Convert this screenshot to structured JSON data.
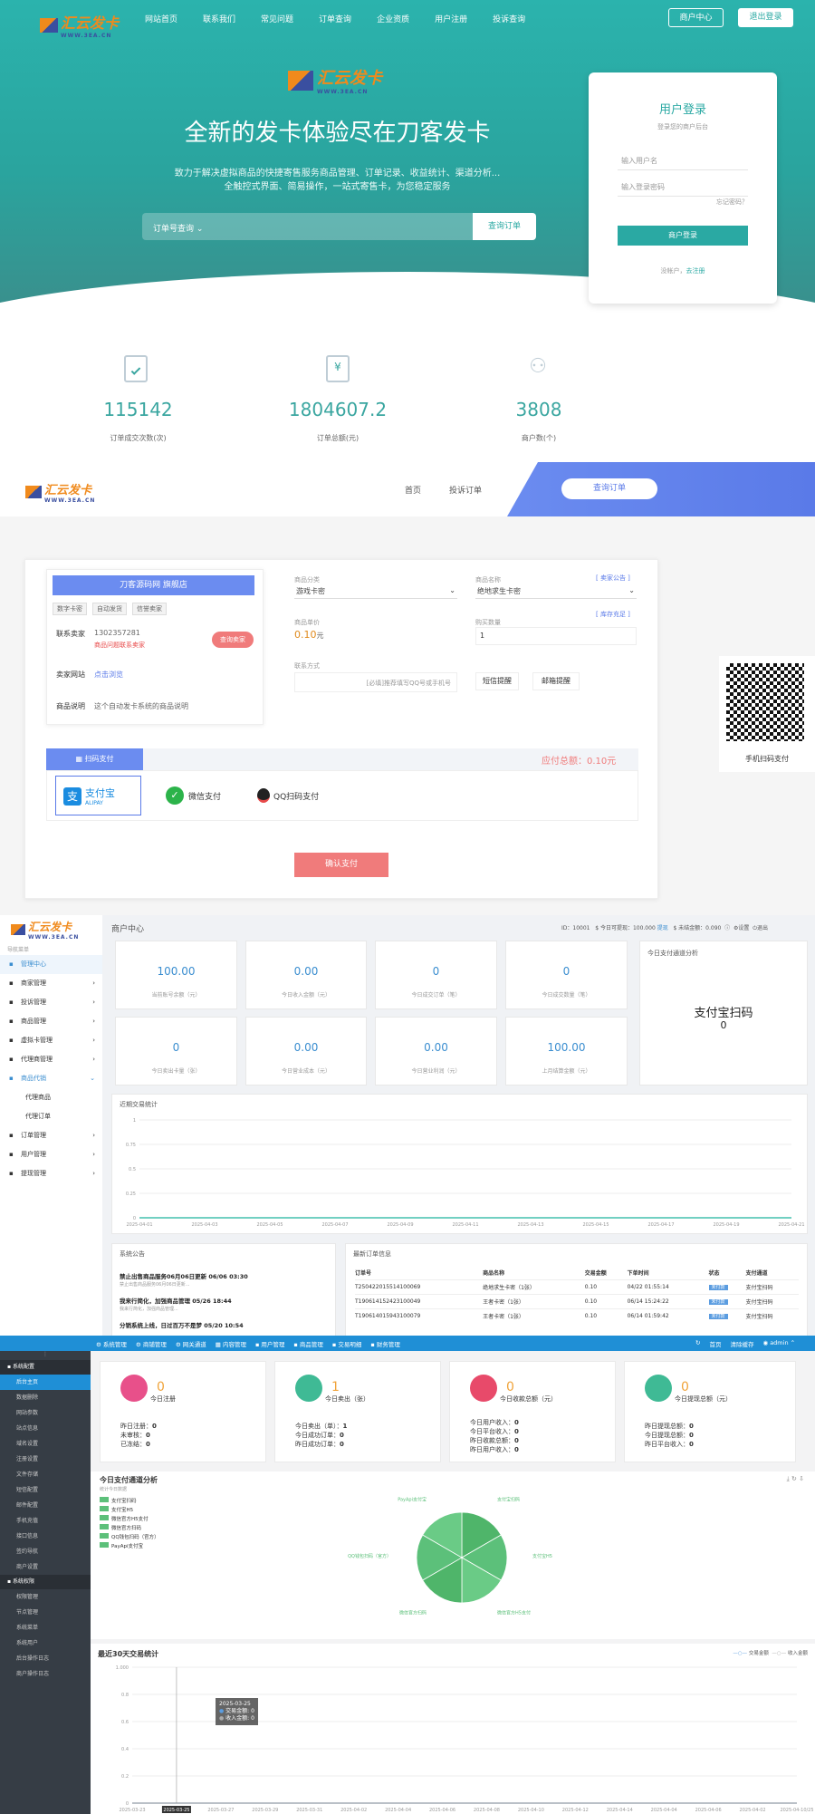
{
  "hero": {
    "logo": "汇云发卡",
    "logo_sub": "WWW.3EA.CN",
    "nav": [
      "网站首页",
      "联系我们",
      "常见问题",
      "订单查询",
      "企业资质",
      "用户注册",
      "投诉查询"
    ],
    "btn_merchant": "商户中心",
    "btn_logout": "退出登录",
    "headline": "全新的发卡体验尽在刀客发卡",
    "desc1": "致力于解决虚拟商品的快捷寄售服务商品管理、订单记录、收益统计、渠道分析...",
    "desc2": "全触控式界面、简易操作，一站式寄售卡，为您稳定服务",
    "search_select": "订单号查询",
    "search_button": "查询订单",
    "login": {
      "title": "用户登录",
      "subtitle": "登录您的商户后台",
      "user_placeholder": "输入用户名",
      "pass_placeholder": "输入登录密码",
      "forgot": "忘记密码？",
      "button": "商户登录",
      "no_account": "没帐户，",
      "register": "去注册"
    }
  },
  "stats": [
    {
      "value": "115142",
      "label": "订单成交次数(次)"
    },
    {
      "value": "1804607.2",
      "label": "订单总额(元)"
    },
    {
      "value": "3808",
      "label": "商户数(个)"
    }
  ],
  "shop": {
    "logo": "汇云发卡",
    "logo_sub": "WWW.3EA.CN",
    "nav_home": "首页",
    "nav_complaint": "投诉订单",
    "nav_query": "查询订单",
    "store_name": "刀客源码网 旗舰店",
    "tags": [
      "数字卡密",
      "自动发货",
      "信誉卖家"
    ],
    "contact_label": "联系卖家",
    "contact_value": "1302357281",
    "contact_warn": "商品问题联系卖家",
    "seller_btn": "查询卖家",
    "site_label": "卖家网站",
    "site_value": "点击浏览",
    "desc_label": "商品说明",
    "desc_value": "这个自动发卡系统的商品说明",
    "category_label": "商品分类",
    "category_value": "游戏卡密",
    "notice_link": "[ 卖家公告 ]",
    "product_label": "商品名称",
    "product_value": "绝地求生卡密",
    "price_label": "商品单价",
    "price_value": "0.10",
    "price_unit": "元",
    "stock_link": "[ 库存充足 ]",
    "qty_label": "购买数量",
    "qty_value": "1",
    "contact_way_label": "联系方式",
    "contact_way_placeholder": "[必填]推荐填写QQ号或手机号",
    "sms_btn": "短信提醒",
    "mail_btn": "邮箱提醒",
    "pay_tab": "扫码支付",
    "total_label": "应付总额：",
    "total_value": "0.10元",
    "pay_alipay": "支付宝",
    "pay_alipay_sub": "ALIPAY",
    "pay_wechat": "微信支付",
    "pay_qq": "QQ扫码支付",
    "confirm": "确认支付",
    "qr_label": "手机扫码支付"
  },
  "merchant": {
    "title": "商户中心",
    "top_id": "ID：10001",
    "top_balance": "$ 今日可提现：100.000",
    "top_withdraw": "提现",
    "top_unsettled": "$ 未结金额：0.090",
    "top_settings": "设置",
    "top_logout": "退出",
    "side_head": "导航菜单",
    "side": [
      "管理中心",
      "商家管理",
      "投诉管理",
      "商品管理",
      "虚拟卡管理",
      "代理商管理",
      "商品代销",
      "代理商品",
      "代理订单",
      "订单管理",
      "用户管理",
      "提现管理"
    ],
    "tiles": [
      {
        "value": "100.00",
        "label": "当前账号余额（元）"
      },
      {
        "value": "0.00",
        "label": "今日收入金额（元）"
      },
      {
        "value": "0",
        "label": "今日成交订单（笔）"
      },
      {
        "value": "0",
        "label": "今日成交数量（笔）"
      },
      {
        "value": "0",
        "label": "今日卖出卡量（张）"
      },
      {
        "value": "0.00",
        "label": "今日营业成本（元）"
      },
      {
        "value": "0.00",
        "label": "今日营业利润（元）"
      },
      {
        "value": "100.00",
        "label": "上月结算金额（元）"
      }
    ],
    "channel_title": "今日支付通道分析",
    "channel_name": "支付宝扫码",
    "channel_value": "0",
    "chart_title": "近期交易统计",
    "notice_title": "系统公告",
    "notices": [
      {
        "title": "禁止出售商品服务06月06日更新 06/06 03:30",
        "sub": "禁止出售商品服务06月06日更新..."
      },
      {
        "title": "我来行简化，加强商品管理 05/26 18:44",
        "sub": "我来行简化，加强商品管理..."
      },
      {
        "title": "分销系统上线，日过百万不是梦 05/20 10:54",
        "sub": ""
      }
    ],
    "orders_title": "最新订单信息",
    "orders_head": [
      "订单号",
      "商品名称",
      "交易金额",
      "下单时间",
      "状态",
      "支付通道"
    ],
    "orders": [
      [
        "T250422015514100069",
        "绝地求生卡密（1张）",
        "0.10",
        "04/22 01:55:14",
        "未付款",
        "支付宝扫码"
      ],
      [
        "T190614152423100049",
        "王者卡密（1张）",
        "0.10",
        "06/14 15:24:22",
        "未付款",
        "支付宝扫码"
      ],
      [
        "T190614015943100079",
        "王者卡密（1张）",
        "0.10",
        "06/14 01:59:42",
        "未付款",
        "支付宝扫码"
      ]
    ]
  },
  "admin": {
    "top_menu": [
      "系统管理",
      "商铺管理",
      "网关通道",
      "内容管理",
      "用户管理",
      "商品管理",
      "交易明细",
      "财务管理"
    ],
    "top_right": [
      "首页",
      "清除缓存",
      "admin"
    ],
    "side_groups": [
      {
        "head": "系统配置",
        "items": [
          "后台主页",
          "数据删除",
          "网站参数",
          "站点信息",
          "域名设置",
          "注册设置",
          "文件存储",
          "短信配置",
          "邮件配置",
          "手机充值",
          "接口信息",
          "签约导航",
          "商户设置"
        ]
      },
      {
        "head": "系统权限",
        "items": [
          "权限管理",
          "节点管理",
          "系统菜单",
          "系统用户",
          "后台操作日志",
          "商户操作日志"
        ]
      }
    ],
    "cards": [
      {
        "value": "0",
        "label": "今日注册",
        "rows": [
          [
            "昨日注册：",
            "0"
          ],
          [
            "未审核：",
            "0"
          ],
          [
            "已冻结：",
            "0"
          ]
        ],
        "color": "#e8508a"
      },
      {
        "value": "1",
        "label": "今日卖出（张）",
        "rows": [
          [
            "今日卖出（单）：",
            "1"
          ],
          [
            "今日成功订单：",
            "0"
          ],
          [
            "昨日成功订单：",
            "0"
          ]
        ],
        "color": "#3fba95"
      },
      {
        "value": "0",
        "label": "今日收款总额（元）",
        "rows": [
          [
            "今日用户收入：",
            "0"
          ],
          [
            "今日平台收入：",
            "0"
          ],
          [
            "昨日收款总额：",
            "0"
          ],
          [
            "昨日用户收入：",
            "0"
          ]
        ],
        "color": "#e84a6a"
      },
      {
        "value": "0",
        "label": "今日提现总额（元）",
        "rows": [
          [
            "昨日提现总额：",
            "0"
          ],
          [
            "今日提现总额：",
            "0"
          ],
          [
            "昨日平台收入：",
            "0"
          ]
        ],
        "color": "#3fba95"
      }
    ],
    "pie_title": "今日支付通道分析",
    "pie_sub": "统计今日数据",
    "pie_legend": [
      "支付宝扫码",
      "支付宝H5",
      "微信官方H5支付",
      "微信官方扫码",
      "QQ钱包扫码（官方）",
      "PayApi支付宝"
    ],
    "pie_labels": [
      "PayApi支付宝",
      "支付宝扫码",
      "支付宝H5",
      "微信官方H5支付",
      "微信官方扫码",
      "QQ钱包扫码（官方）"
    ],
    "line_title": "最近30天交易统计",
    "line_legend": [
      "交易金额",
      "收入金额"
    ],
    "tooltip": {
      "date": "2025-03-25",
      "amount": "交易金额: 0",
      "income": "收入金额: 0"
    }
  },
  "chart_data": [
    {
      "type": "line",
      "title": "近期交易统计",
      "x": [
        "2025-04-01",
        "2025-04-03",
        "2025-04-05",
        "2025-04-07",
        "2025-04-09",
        "2025-04-11",
        "2025-04-13",
        "2025-04-15",
        "2025-04-17",
        "2025-04-19",
        "2025-04-21"
      ],
      "series": [
        {
          "values": [
            0,
            0,
            0,
            0,
            0,
            0,
            0,
            0,
            0,
            0,
            0
          ]
        }
      ],
      "yticks": [
        "1",
        "0.75",
        "0.5",
        "0.25",
        "0"
      ],
      "ylim": [
        0,
        1
      ]
    },
    {
      "type": "pie",
      "title": "今日支付通道分析",
      "categories": [
        "支付宝扫码",
        "支付宝H5",
        "微信官方H5支付",
        "微信官方扫码",
        "QQ钱包扫码（官方）",
        "PayApi支付宝"
      ],
      "values": [
        1,
        1,
        1,
        1,
        1,
        1
      ]
    },
    {
      "type": "line",
      "title": "最近30天交易统计",
      "x": [
        "2025-03-23",
        "2025-03-25",
        "2025-03-27",
        "2025-03-29",
        "2025-03-31",
        "2025-04-02",
        "2025-04-04",
        "2025-04-06",
        "2025-04-08",
        "2025-04-10",
        "2025-04-12",
        "2025-04-14",
        "2025-04-04",
        "2025-04-06",
        "2025-04-02",
        "2025-04-10/25"
      ],
      "series": [
        {
          "name": "交易金额",
          "values": [
            0,
            0,
            0,
            0,
            0,
            0,
            0,
            0,
            0,
            0,
            0,
            0,
            0,
            0,
            0,
            0
          ]
        },
        {
          "name": "收入金额",
          "values": [
            0,
            0,
            0,
            0,
            0,
            0,
            0,
            0,
            0,
            0,
            0,
            0,
            0,
            0,
            0,
            0
          ]
        }
      ],
      "yticks": [
        "1.000",
        "0.8",
        "0.6",
        "0.4",
        "0.2",
        "0"
      ],
      "ylim": [
        0,
        1
      ]
    }
  ]
}
